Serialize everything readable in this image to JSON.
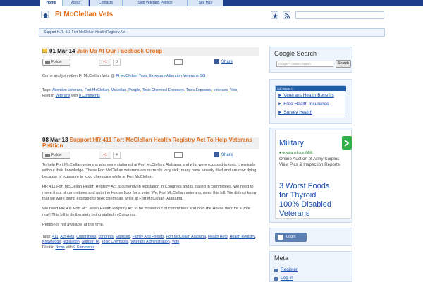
{
  "nav": {
    "tabs": [
      "Home",
      "About",
      "Contacts",
      "Sign Veterans Petition",
      "Site Map"
    ],
    "active": 0
  },
  "header": {
    "title": "Ft McClellan Vets"
  },
  "breadcrumb": "Support H.R. 411 Fort McClellan Health Registry Act",
  "posts": [
    {
      "date": "01 Mar 14",
      "title": "Join Us At Our Facebook Group",
      "follow_label": "Follow",
      "gplus_label": "+1",
      "gplus_count": "0",
      "share_label": "Share",
      "body_prefix": "Come and join other Ft McClellan Vets @ ",
      "body_link": "Ft McClellan Toxic Exposure Attention Veterans SG",
      "tags_label": "Tags: ",
      "tags": [
        "Attention Veterans",
        "Fort McClellan",
        "Mcclellan",
        "People",
        "Toxic Chemical Exposure",
        "Toxic Exposure",
        "veterans",
        "Vets"
      ],
      "filed_prefix": "Filed in ",
      "filed_cat": "Veterans",
      "filed_mid": " with ",
      "comments": "0 Comments"
    },
    {
      "date": "08 Mar 13",
      "title": "Support HR 411 Fort McClellan Health Registry Act To Help Veterans Petition",
      "follow_label": "Follow",
      "gplus_label": "+1",
      "gplus_count": "4",
      "share_label": "Share",
      "paragraphs": [
        "To help Fort McClellan veterans who were stationed at Fort McClellan, Alabama and who were exposed to toxic chemicals without their knowledge. These Fort McClellan veterans are currently very sick, many have already died and are now dying because of exposure to toxic chemicals while at Fort McClellan.",
        "HR 411 Fort McClellan Health Registry Act is currently in legislation in Congress and is stalled in committees. We need to move it out of committees and onto the House floor for a vote. We, Fort McClellan veterans, need this bill. We did not know that we were being exposed to toxic chemicals while at Fort McClellan, Alabama.",
        "We need HR 411 Fort McClellan Health Registry Act to be moved out of committees and onto the House floor for a vote now! This bill is deliberately being stalled in Congress.",
        "Petition is not available at this time."
      ],
      "tags_label": "Tags: ",
      "tags": [
        "411",
        "Act Help",
        "Committees",
        "congress",
        "Exposed",
        "Family And Friends",
        "Fort McClellan Alabama",
        "Health Help",
        "Health Registry",
        "Knowledge",
        "legislation",
        "Support Hr",
        "Toxic Chemicals",
        "Veterans Administration",
        "Vote"
      ],
      "filed_prefix": "Filed in ",
      "filed_cat": "News",
      "filed_mid": " with ",
      "comments": "0 Comments"
    }
  ],
  "sidebar": {
    "google_search": {
      "title": "Google Search",
      "placeholder": "Google™ Custom Search",
      "button": "Search"
    },
    "adlinks": {
      "adchoices": "AdChoices ▷",
      "links": [
        "► Veterans Health Benefits",
        "► Free Health Insurance",
        "► Survey Health"
      ]
    },
    "ad": {
      "title": "Military",
      "url": "govplanet.com/Milit..",
      "desc": "Online Auction of Army Surplus View Pics & Inspection Reports",
      "line1": "3 Worst Foods",
      "line2": "for Thyroid",
      "line3": "100% Disabled",
      "line4": "Veterans"
    },
    "login": "Login",
    "meta": {
      "title": "Meta",
      "items": [
        "Register",
        "Log in"
      ]
    }
  },
  "colors": {
    "accent": "#e1701e",
    "nav": "#1d3f8a",
    "link": "#1a4fb0"
  }
}
